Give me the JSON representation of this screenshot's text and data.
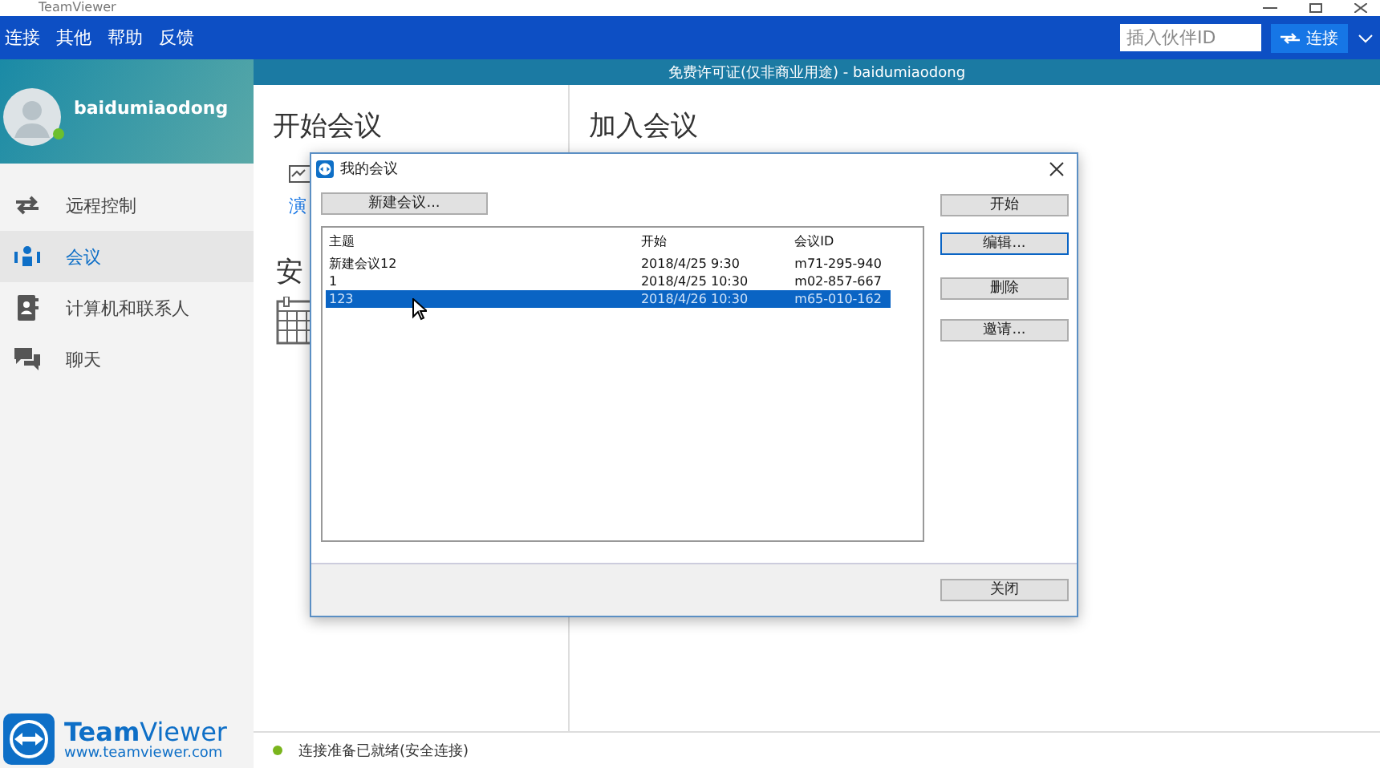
{
  "window": {
    "title": "TeamViewer"
  },
  "menu": [
    "连接",
    "其他",
    "帮助",
    "反馈"
  ],
  "partner_id": {
    "placeholder": "插入伙伴ID"
  },
  "connect_button": "连接",
  "license_bar": "免费许可证(仅非商业用途) - baidumiaodong",
  "profile": {
    "username": "baidumiaodong",
    "online": true
  },
  "nav": [
    {
      "label": "远程控制",
      "selected": false
    },
    {
      "label": "会议",
      "selected": true
    },
    {
      "label": "计算机和联系人",
      "selected": false
    },
    {
      "label": "聊天",
      "selected": false
    }
  ],
  "logo": {
    "name": "**Team**Viewer",
    "url": "www.teamviewer.com"
  },
  "start_panel": {
    "title": "开始会议",
    "link": "演",
    "section": "安"
  },
  "join_panel": {
    "title": "加入会议"
  },
  "status_bar": {
    "text": "连接准备已就绪(安全连接)",
    "ready": true
  },
  "dialog": {
    "title": "我的会议",
    "new_button": "新建会议...",
    "columns": [
      "主题",
      "开始",
      "会议ID"
    ],
    "rows": [
      {
        "cells": [
          "新建会议12",
          "2018/4/25 9:30",
          "m71-295-940"
        ],
        "selected": false
      },
      {
        "cells": [
          "1",
          "2018/4/25 10:30",
          "m02-857-667"
        ],
        "selected": false
      },
      {
        "cells": [
          "123",
          "2018/4/26 10:30",
          "m65-010-162"
        ],
        "selected": true
      }
    ],
    "actions": [
      {
        "label": "开始",
        "focused": false
      },
      {
        "label": "编辑...",
        "focused": true
      },
      {
        "label": "删除",
        "focused": false
      },
      {
        "label": "邀请...",
        "focused": false
      }
    ],
    "close_button": "关闭"
  }
}
